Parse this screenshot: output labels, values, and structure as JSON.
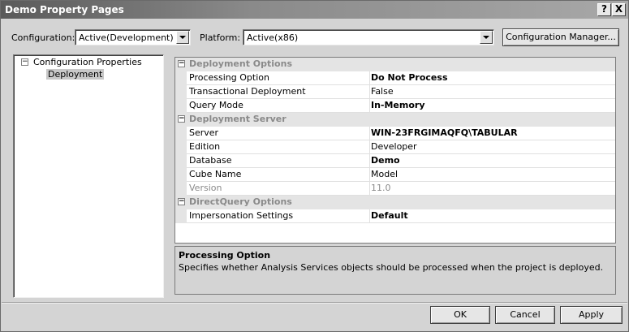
{
  "window": {
    "title": "Demo Property Pages",
    "help_glyph": "?",
    "close_glyph": "X"
  },
  "toolbar": {
    "configuration_label": "Configuration:",
    "configuration_value": "Active(Development)",
    "platform_label": "Platform:",
    "platform_value": "Active(x86)",
    "config_manager_label": "Configuration Manager..."
  },
  "tree": {
    "root": {
      "label": "Configuration Properties",
      "expander": "−"
    },
    "children": [
      {
        "label": "Deployment",
        "selected": true
      }
    ]
  },
  "grid": {
    "categories": [
      {
        "name": "Deployment Options",
        "expander": "−",
        "rows": [
          {
            "name": "Processing Option",
            "value": "Do Not Process",
            "bold": true
          },
          {
            "name": "Transactional Deployment",
            "value": "False",
            "bold": false
          },
          {
            "name": "Query Mode",
            "value": "In-Memory",
            "bold": true
          }
        ]
      },
      {
        "name": "Deployment Server",
        "expander": "−",
        "rows": [
          {
            "name": "Server",
            "value": "WIN-23FRGIMAQFQ\\TABULAR",
            "bold": true
          },
          {
            "name": "Edition",
            "value": "Developer",
            "bold": false
          },
          {
            "name": "Database",
            "value": "Demo",
            "bold": true
          },
          {
            "name": "Cube Name",
            "value": "Model",
            "bold": false
          },
          {
            "name": "Version",
            "value": "11.0",
            "bold": false,
            "dim": true
          }
        ]
      },
      {
        "name": "DirectQuery Options",
        "expander": "−",
        "rows": [
          {
            "name": "Impersonation Settings",
            "value": "Default",
            "bold": true
          }
        ]
      }
    ]
  },
  "description": {
    "title": "Processing Option",
    "text": "Specifies whether Analysis Services objects should be processed when the project is deployed."
  },
  "footer": {
    "ok_label": "OK",
    "cancel_label": "Cancel",
    "apply_label": "Apply"
  }
}
